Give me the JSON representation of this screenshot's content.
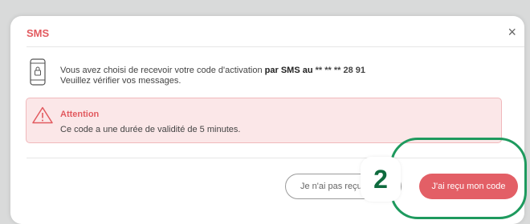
{
  "modal": {
    "title": "SMS",
    "close_symbol": "×",
    "message": {
      "part1": "Vous avez choisi de recevoir votre code d'activation ",
      "bold": "par SMS au",
      "masked_number": " ** ** ** 28 91",
      "line2": "Veuillez vérifier vos messages."
    },
    "icons": {
      "phone": "phone-lock-icon",
      "warning": "warning-icon"
    },
    "alert": {
      "title": "Attention",
      "text": "Ce code a une durée de validité de 5 minutes."
    },
    "buttons": {
      "secondary_label": "Je n'ai pas reçu mon code",
      "primary_label": "J'ai reçu mon code"
    }
  },
  "annotation": {
    "step_number": "2"
  },
  "colors": {
    "accent": "#e25a5f",
    "primary_button": "#e35f66",
    "alert_bg": "#fbe7e8",
    "alert_border": "#f0b8bb",
    "annotation_green": "#1e9a5e"
  }
}
